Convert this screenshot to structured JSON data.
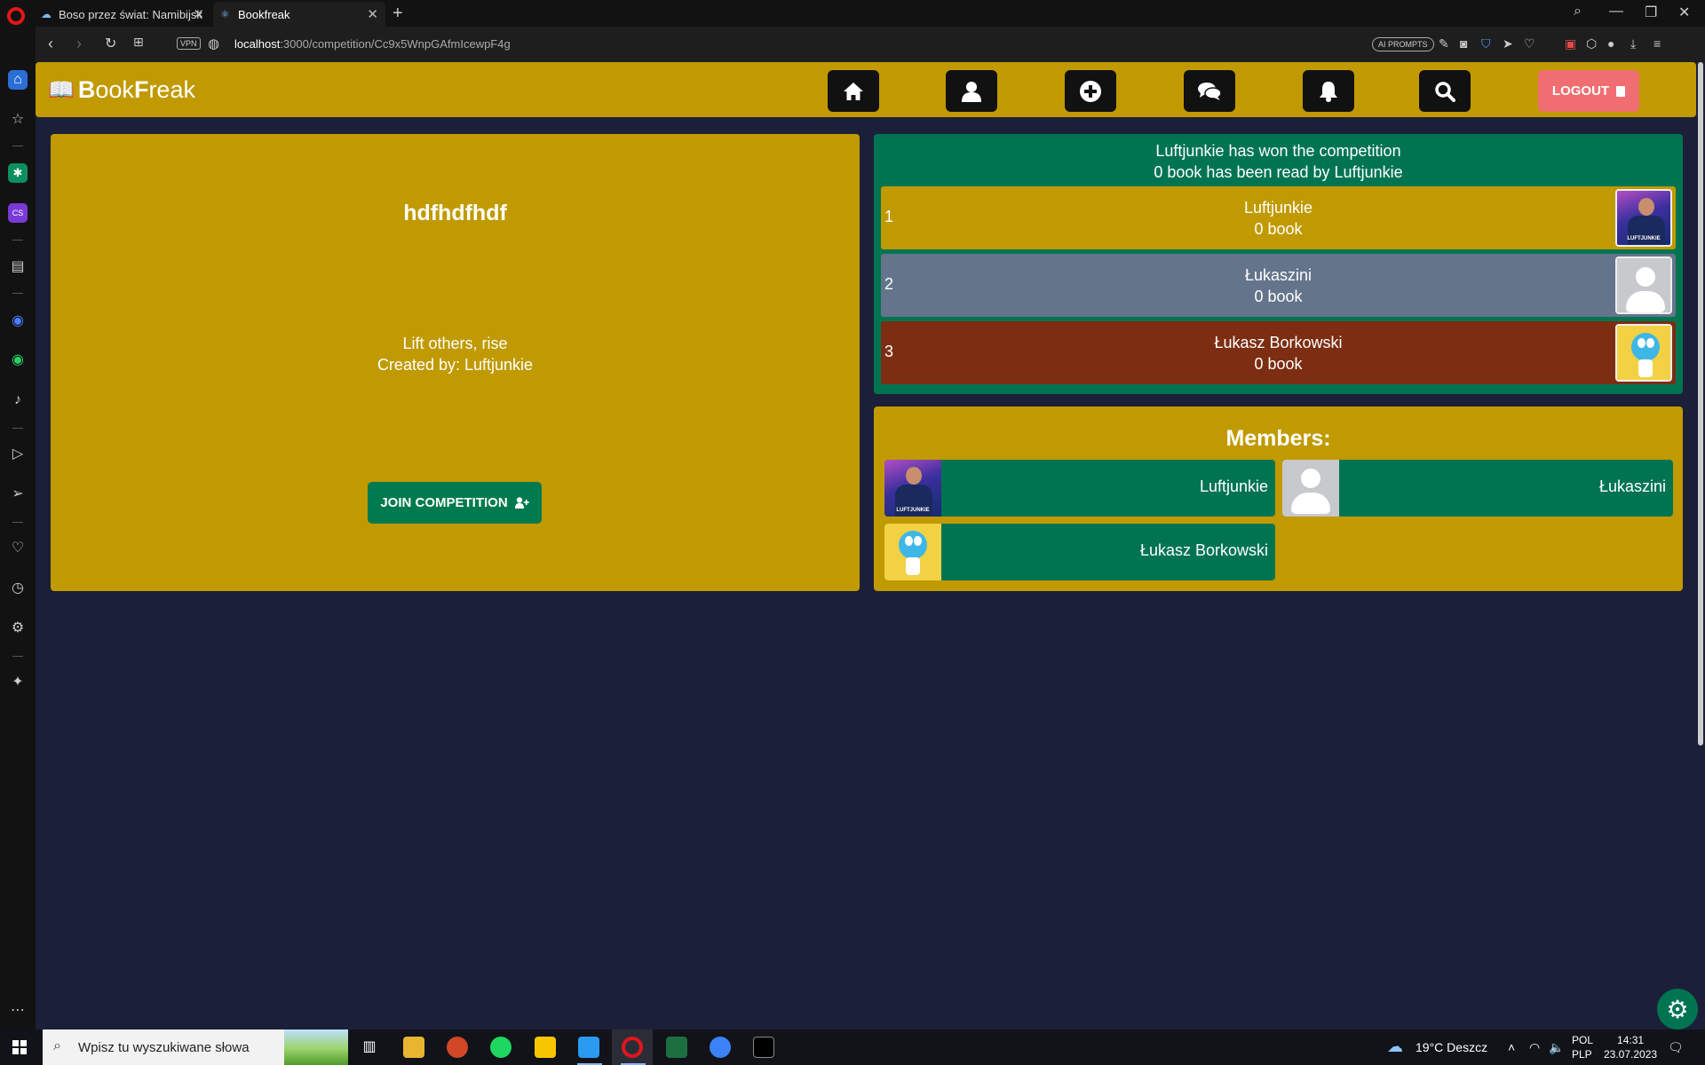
{
  "browser": {
    "tabs": [
      {
        "title": "Boso przez świat: Namibijsk",
        "active": false
      },
      {
        "title": "Bookfreak",
        "active": true
      }
    ],
    "url_host": "localhost",
    "url_rest": ":3000/competition/Cc9x5WnpGAfmIcewpF4g",
    "vpn_label": "VPN",
    "ai_prompts_label": "AI PROMPTS"
  },
  "app": {
    "logo_strong_1": "B",
    "logo_light_1": "ook",
    "logo_strong_2": "F",
    "logo_light_2": "reak",
    "logout_label": "LOGOUT",
    "nav_icons": [
      "home-icon",
      "user-icon",
      "plus-circle-icon",
      "comments-icon",
      "bell-icon",
      "search-icon"
    ]
  },
  "competition": {
    "title": "hdfhdfhdf",
    "description": "Lift others, rise",
    "created_by": "Created by: Luftjunkie",
    "join_label": "JOIN COMPETITION"
  },
  "winner": {
    "line1": "Luftjunkie has won the competition",
    "line2": "0 book has been read by Luftjunkie"
  },
  "ranking": [
    {
      "rank": "1",
      "name": "Luftjunkie",
      "books": "0 book",
      "color": "#c09a00",
      "avatar": "photo"
    },
    {
      "rank": "2",
      "name": "Łukaszini",
      "books": "0 book",
      "color": "#64748b",
      "avatar": "default"
    },
    {
      "rank": "3",
      "name": "Łukasz Borkowski",
      "books": "0 book",
      "color": "#7c2d12",
      "avatar": "gumball"
    }
  ],
  "members": {
    "title": "Members:",
    "list": [
      {
        "name": "Luftjunkie",
        "avatar": "photo"
      },
      {
        "name": "Łukaszini",
        "avatar": "default"
      },
      {
        "name": "Łukasz Borkowski",
        "avatar": "gumball"
      }
    ]
  },
  "avatar_label": "LUFTJUNKIE",
  "taskbar": {
    "search_placeholder": "Wpisz tu wyszukiwane słowa",
    "weather": "19°C  Deszcz",
    "lang_1": "POL",
    "lang_2": "PLP",
    "time": "14:31",
    "date": "23.07.2023"
  },
  "colors": {
    "accent_gold": "#c09a00",
    "accent_green": "#007451",
    "logout": "#f06e72",
    "background": "#1b2038"
  }
}
